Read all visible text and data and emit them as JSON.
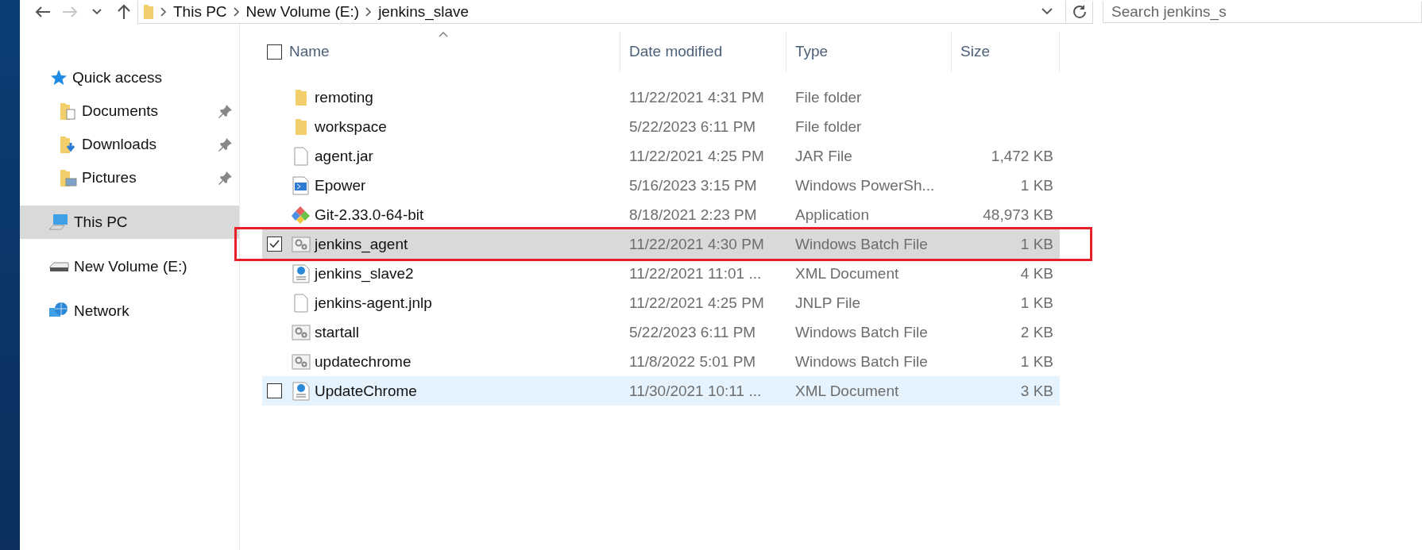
{
  "toolbar": {
    "back_disabled": false,
    "forward_disabled": true,
    "breadcrumb": [
      "This PC",
      "New Volume (E:)",
      "jenkins_slave"
    ],
    "search": {
      "placeholder": "Search jenkins_s"
    }
  },
  "sidebar": {
    "items": [
      {
        "label": "Quick access",
        "kind": "star",
        "selected": false,
        "children": [
          {
            "label": "Documents",
            "kind": "documents",
            "pinned": true,
            "selected": false
          },
          {
            "label": "Downloads",
            "kind": "downloads",
            "pinned": true,
            "selected": false
          },
          {
            "label": "Pictures",
            "kind": "pictures",
            "pinned": true,
            "selected": false
          }
        ]
      },
      {
        "label": "This PC",
        "kind": "computer",
        "selected": true
      },
      {
        "label": "New Volume (E:)",
        "kind": "drive",
        "selected": false
      },
      {
        "label": "Network",
        "kind": "network",
        "selected": false
      }
    ]
  },
  "table": {
    "columns": [
      {
        "label": "Name",
        "sorted": true
      },
      {
        "label": "Date modified",
        "sorted": false
      },
      {
        "label": "Type",
        "sorted": false
      },
      {
        "label": "Size",
        "sorted": false
      }
    ],
    "header_checked": false,
    "rows": [
      {
        "name": "remoting",
        "date": "11/22/2021 4:31 PM",
        "type": "File folder",
        "kind": "folder",
        "selected": false,
        "hovered": false,
        "annotated": false
      },
      {
        "name": "workspace",
        "date": "5/22/2023 6:11 PM",
        "type": "File folder",
        "kind": "folder",
        "selected": false,
        "hovered": false,
        "annotated": false
      },
      {
        "name": "agent.jar",
        "date": "11/22/2021 4:25 PM",
        "type": "JAR File",
        "size": "1,472 KB",
        "kind": "file",
        "selected": false,
        "hovered": false,
        "annotated": false
      },
      {
        "name": "Epower",
        "date": "5/16/2023 3:15 PM",
        "type": "Windows PowerSh...",
        "size": "1 KB",
        "kind": "script",
        "selected": false,
        "hovered": false,
        "annotated": false
      },
      {
        "name": "Git-2.33.0-64-bit",
        "date": "8/18/2021 2:23 PM",
        "type": "Application",
        "size": "48,973 KB",
        "kind": "app",
        "selected": false,
        "hovered": false,
        "annotated": false
      },
      {
        "name": "jenkins_agent",
        "date": "11/22/2021 4:30 PM",
        "type": "Windows Batch File",
        "size": "1 KB",
        "kind": "batch",
        "selected": true,
        "hovered": false,
        "annotated": true
      },
      {
        "name": "jenkins_slave2",
        "date": "11/22/2021 11:01 ...",
        "type": "XML Document",
        "size": "4 KB",
        "kind": "xml",
        "selected": false,
        "hovered": false,
        "annotated": false
      },
      {
        "name": "jenkins-agent.jnlp",
        "date": "11/22/2021 4:25 PM",
        "type": "JNLP File",
        "size": "1 KB",
        "kind": "file",
        "selected": false,
        "hovered": false,
        "annotated": false
      },
      {
        "name": "startall",
        "date": "5/22/2023 6:11 PM",
        "type": "Windows Batch File",
        "size": "2 KB",
        "kind": "batch",
        "selected": false,
        "hovered": false,
        "annotated": false
      },
      {
        "name": "updatechrome",
        "date": "11/8/2022 5:01 PM",
        "type": "Windows Batch File",
        "size": "1 KB",
        "kind": "batch",
        "selected": false,
        "hovered": false,
        "annotated": false
      },
      {
        "name": "UpdateChrome",
        "date": "11/30/2021 10:11 ...",
        "type": "XML Document",
        "size": "3 KB",
        "kind": "xml",
        "selected": false,
        "hovered": true,
        "annotated": false
      }
    ]
  }
}
